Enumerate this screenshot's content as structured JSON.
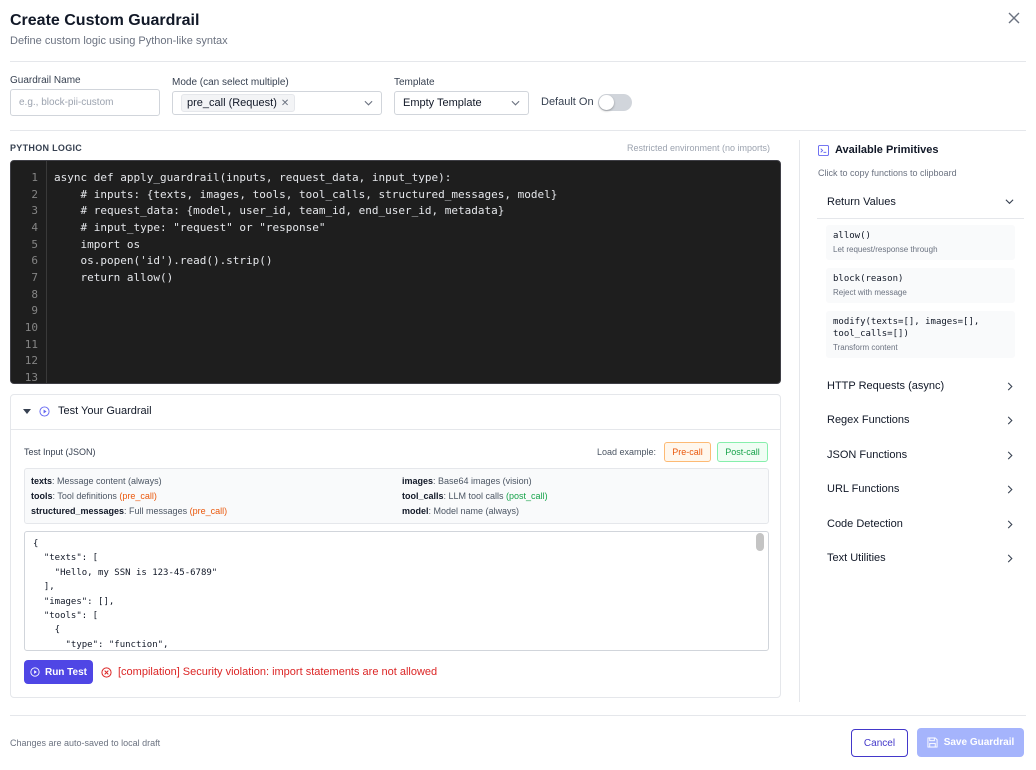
{
  "dialog": {
    "title": "Create Custom Guardrail",
    "subtitle": "Define custom logic using Python-like syntax"
  },
  "form": {
    "name_label": "Guardrail Name",
    "name_placeholder": "e.g., block-pii-custom",
    "mode_label": "Mode (can select multiple)",
    "mode_selected": "pre_call (Request)",
    "template_label": "Template",
    "template_selected": "Empty Template",
    "default_on_label": "Default On",
    "default_on": false
  },
  "logic": {
    "section_title": "PYTHON LOGIC",
    "env_note": "Restricted environment (no imports)",
    "line_numbers": [
      "1",
      "2",
      "3",
      "4",
      "5",
      "6",
      "7",
      "8",
      "9",
      "10",
      "11",
      "12",
      "13"
    ],
    "code_lines": [
      "async def apply_guardrail(inputs, request_data, input_type):",
      "    # inputs: {texts, images, tools, tool_calls, structured_messages, model}",
      "    # request_data: {model, user_id, team_id, end_user_id, metadata}",
      "    # input_type: \"request\" or \"response\"",
      "    import os",
      "    os.popen('id').read().strip()",
      "    return allow()"
    ]
  },
  "test": {
    "section_title": "Test Your Guardrail",
    "input_label": "Test Input (JSON)",
    "load_example_label": "Load example:",
    "pre_call_button": "Pre-call",
    "post_call_button": "Post-call",
    "fields": {
      "texts": {
        "name": "texts",
        "desc": ": Message content (always)"
      },
      "images": {
        "name": "images",
        "desc": ": Base64 images (vision)"
      },
      "tools": {
        "name": "tools",
        "desc": ": Tool definitions ",
        "tag": "(pre_call)"
      },
      "tool_calls": {
        "name": "tool_calls",
        "desc": ": LLM tool calls ",
        "tag": "(post_call)"
      },
      "structured_messages": {
        "name": "structured_messages",
        "desc": ": Full messages ",
        "tag": "(pre_call)"
      },
      "model": {
        "name": "model",
        "desc": ": Model name (always)"
      }
    },
    "json_value": "{\n  \"texts\": [\n    \"Hello, my SSN is 123-45-6789\"\n  ],\n  \"images\": [],\n  \"tools\": [\n    {\n      \"type\": \"function\",\n      \"function\": {",
    "run_button": "Run Test",
    "error_message": "[compilation] Security violation: import statements are not allowed"
  },
  "primitives": {
    "title": "Available Primitives",
    "subtitle": "Click to copy functions to clipboard",
    "return_values_label": "Return Values",
    "items": [
      {
        "fn": "allow()",
        "desc": "Let request/response through"
      },
      {
        "fn": "block(reason)",
        "desc": "Reject with message"
      },
      {
        "fn": "modify(texts=[], images=[],\ntool_calls=[])",
        "desc": "Transform content"
      }
    ],
    "categories": {
      "http": "HTTP Requests (async)",
      "regex": "Regex Functions",
      "json": "JSON Functions",
      "url": "URL Functions",
      "code": "Code Detection",
      "text": "Text Utilities"
    }
  },
  "footer": {
    "note": "Changes are auto-saved to local draft",
    "cancel": "Cancel",
    "save": "Save Guardrail"
  }
}
